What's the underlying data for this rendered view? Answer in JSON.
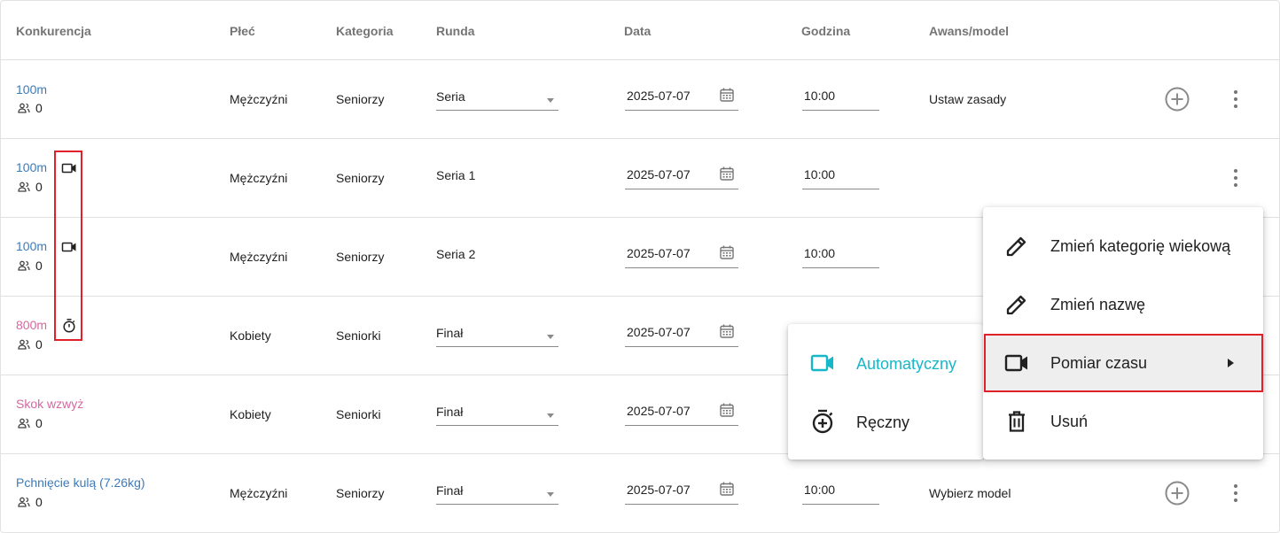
{
  "headers": {
    "konkurencja": "Konkurencja",
    "plec": "Płeć",
    "kategoria": "Kategoria",
    "runda": "Runda",
    "data": "Data",
    "godzina": "Godzina",
    "awans": "Awans/model"
  },
  "colors": {
    "link_blue": "#3d7ab8",
    "link_pink": "#d6679f",
    "accent": "#16b7c9",
    "highlight": "#e0212b"
  },
  "rows": [
    {
      "name": "100m",
      "count": "0",
      "plec": "Mężczyźni",
      "kategoria": "Seniorzy",
      "runda": "Seria",
      "data": "2025-07-07",
      "godzina": "10:00",
      "awans": "Ustaw zasady",
      "timing_icon": "none"
    },
    {
      "name": "100m",
      "count": "0",
      "plec": "Mężczyźni",
      "kategoria": "Seniorzy",
      "runda": "Seria 1",
      "data": "2025-07-07",
      "godzina": "10:00",
      "awans": "",
      "timing_icon": "video-camera-icon"
    },
    {
      "name": "100m",
      "count": "0",
      "plec": "Mężczyźni",
      "kategoria": "Seniorzy",
      "runda": "Seria 2",
      "data": "2025-07-07",
      "godzina": "10:00",
      "awans": "",
      "timing_icon": "video-camera-icon"
    },
    {
      "name": "800m",
      "count": "0",
      "plec": "Kobiety",
      "kategoria": "Seniorki",
      "runda": "Finał",
      "data": "2025-07-07",
      "godzina": "",
      "awans": "",
      "timing_icon": "stopwatch-icon"
    },
    {
      "name": "Skok wzwyż",
      "count": "0",
      "plec": "Kobiety",
      "kategoria": "Seniorki",
      "runda": "Finał",
      "data": "2025-07-07",
      "godzina": "",
      "awans": "",
      "timing_icon": "none"
    },
    {
      "name": "Pchnięcie kulą (7.26kg)",
      "count": "0",
      "plec": "Mężczyźni",
      "kategoria": "Seniorzy",
      "runda": "Finał",
      "data": "2025-07-07",
      "godzina": "10:00",
      "awans": "Wybierz model",
      "timing_icon": "none"
    }
  ],
  "context_menu": {
    "items": [
      {
        "label": "Zmień kategorię wiekową",
        "icon": "pencil-icon"
      },
      {
        "label": "Zmień nazwę",
        "icon": "pencil-icon"
      },
      {
        "label": "Pomiar czasu",
        "icon": "video-camera-icon"
      },
      {
        "label": "Usuń",
        "icon": "trash-icon"
      }
    ]
  },
  "submenu": {
    "items": [
      {
        "label": "Automatyczny",
        "icon": "video-camera-icon"
      },
      {
        "label": "Ręczny",
        "icon": "stopwatch-icon"
      }
    ]
  }
}
